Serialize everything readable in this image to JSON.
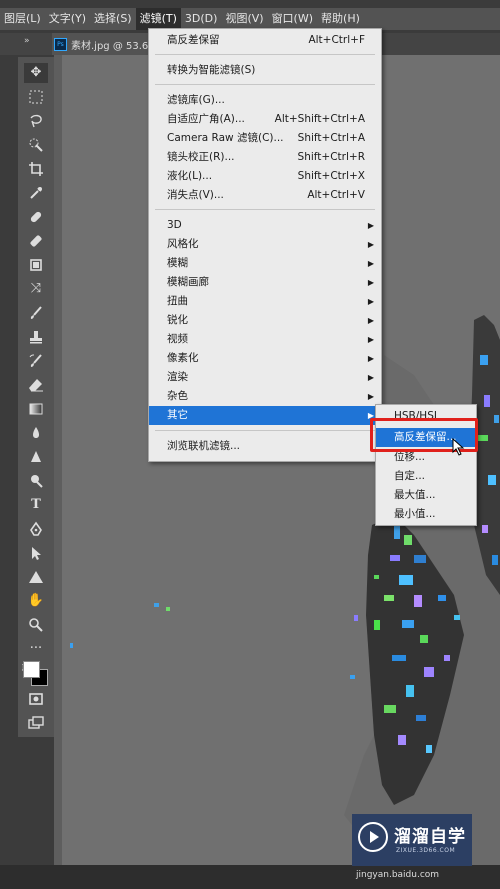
{
  "menubar": {
    "items": [
      "图层(L)",
      "文字(Y)",
      "选择(S)",
      "滤镜(T)",
      "3D(D)",
      "视图(V)",
      "窗口(W)",
      "帮助(H)"
    ],
    "active": "滤镜(T)"
  },
  "document_tab": {
    "ps_badge": "Ps",
    "title": "素材.jpg @ 53.6",
    "panel_toggle": "»"
  },
  "filter_menu": {
    "items": [
      {
        "label": "高反差保留",
        "shortcut": "Alt+Ctrl+F"
      },
      {
        "label": "转换为智能滤镜(S)",
        "shortcut": ""
      },
      {
        "label": "滤镜库(G)...",
        "shortcut": ""
      },
      {
        "label": "自适应广角(A)...",
        "shortcut": "Alt+Shift+Ctrl+A"
      },
      {
        "label": "Camera Raw 滤镜(C)...",
        "shortcut": "Shift+Ctrl+A"
      },
      {
        "label": "镜头校正(R)...",
        "shortcut": "Shift+Ctrl+R"
      },
      {
        "label": "液化(L)...",
        "shortcut": "Shift+Ctrl+X"
      },
      {
        "label": "消失点(V)...",
        "shortcut": "Alt+Ctrl+V"
      },
      {
        "label": "3D",
        "submenu": true
      },
      {
        "label": "风格化",
        "submenu": true
      },
      {
        "label": "模糊",
        "submenu": true
      },
      {
        "label": "模糊画廊",
        "submenu": true
      },
      {
        "label": "扭曲",
        "submenu": true
      },
      {
        "label": "锐化",
        "submenu": true
      },
      {
        "label": "视频",
        "submenu": true
      },
      {
        "label": "像素化",
        "submenu": true
      },
      {
        "label": "渲染",
        "submenu": true
      },
      {
        "label": "杂色",
        "submenu": true
      },
      {
        "label": "其它",
        "submenu": true,
        "highlighted": true
      },
      {
        "label": "浏览联机滤镜...",
        "shortcut": ""
      }
    ]
  },
  "other_submenu": {
    "items": [
      {
        "label": "HSB/HSL"
      },
      {
        "label": "高反差保留...",
        "highlighted": true
      },
      {
        "label": "位移..."
      },
      {
        "label": "自定..."
      },
      {
        "label": "最大值..."
      },
      {
        "label": "最小值..."
      }
    ]
  },
  "toolbar": {
    "icons": [
      "move-icon",
      "marquee-icon",
      "lasso-icon",
      "quick-select-icon",
      "crop-icon",
      "eyedropper-icon",
      "healing-brush-icon",
      "brush-icon",
      "clone-stamp-icon",
      "history-brush-icon",
      "eraser-icon",
      "gradient-icon",
      "blur-icon",
      "dodge-icon",
      "pen-icon",
      "type-icon",
      "path-select-icon",
      "shape-icon",
      "hand-icon",
      "zoom-icon",
      "more-tools-icon",
      "swap-colors-icon",
      "quick-mask-icon",
      "screen-mode-icon"
    ],
    "foreground_color": "#ffffff",
    "background_color": "#000000"
  },
  "colors": {
    "highlight": "#1f74d6",
    "callout_border": "#e0201b"
  },
  "watermark": {
    "brand": "溜溜自学",
    "sub": "ZIXUE.3D66.COM",
    "site": "jingyan.baidu.com"
  }
}
